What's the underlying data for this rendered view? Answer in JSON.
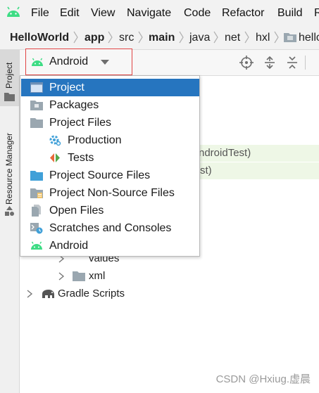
{
  "menu": {
    "items": [
      "File",
      "Edit",
      "View",
      "Navigate",
      "Code",
      "Refactor",
      "Build",
      "R"
    ]
  },
  "breadcrumb": {
    "items": [
      "HelloWorld",
      "app",
      "src",
      "main",
      "java",
      "net",
      "hxl",
      "hello"
    ]
  },
  "left_tabs": {
    "project": "Project",
    "resource_manager": "Resource Manager"
  },
  "view_selector": {
    "selected": "Android"
  },
  "view_menu": {
    "options": [
      {
        "label": "Project",
        "icon": "project-window-icon",
        "selected": true
      },
      {
        "label": "Packages",
        "icon": "packages-folder-icon",
        "selected": false
      },
      {
        "label": "Project Files",
        "icon": "folder-icon",
        "selected": false
      },
      {
        "label": "Production",
        "icon": "production-gear-icon",
        "selected": false
      },
      {
        "label": "Tests",
        "icon": "tests-icon",
        "selected": false
      },
      {
        "label": "Project Source Files",
        "icon": "source-folder-icon",
        "selected": false
      },
      {
        "label": "Project Non-Source Files",
        "icon": "non-source-folder-icon",
        "selected": false
      },
      {
        "label": "Open Files",
        "icon": "open-files-icon",
        "selected": false
      },
      {
        "label": "Scratches and Consoles",
        "icon": "scratches-icon",
        "selected": false
      },
      {
        "label": "Android",
        "icon": "android-icon",
        "selected": false
      }
    ]
  },
  "tree": {
    "partial_android_test": "ndroidTest)",
    "partial_test": "st)",
    "values": "values",
    "xml": "xml",
    "gradle_scripts": "Gradle Scripts"
  },
  "watermark": "CSDN @Hxiug.虚晨",
  "colors": {
    "android_green": "#3ddc84",
    "selection_blue": "#2675bf",
    "highlight_border": "#e14444"
  }
}
